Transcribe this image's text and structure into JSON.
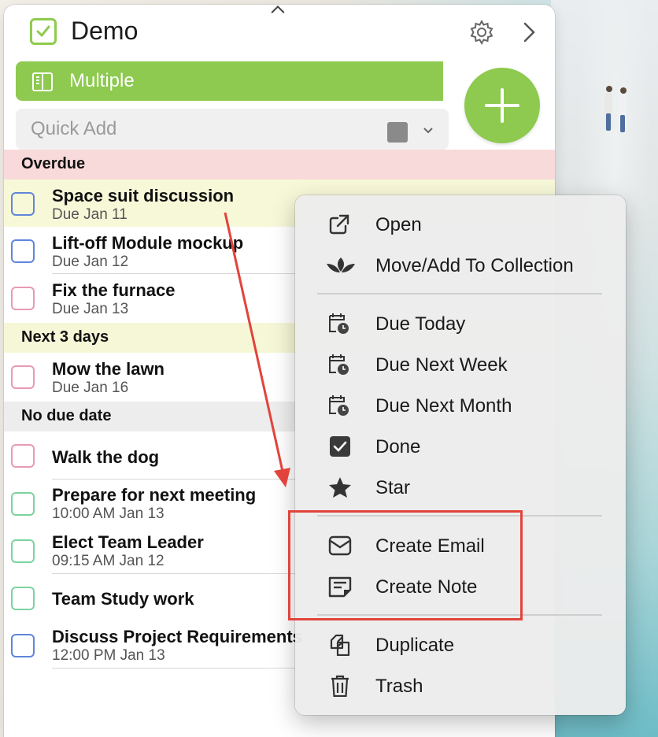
{
  "window": {
    "title": "Demo"
  },
  "filter": {
    "label": "Multiple"
  },
  "quick_add": {
    "placeholder": "Quick Add"
  },
  "sections": {
    "overdue": "Overdue",
    "next_days": "Next 3 days",
    "no_due": "No due date"
  },
  "tasks": [
    {
      "title": "Space suit discussion",
      "subtitle": "Due Jan 11",
      "color": "#5f86d9"
    },
    {
      "title": "Lift-off Module mockup",
      "subtitle": "Due Jan 12",
      "color": "#5f86d9"
    },
    {
      "title": "Fix the furnace",
      "subtitle": "Due Jan 13",
      "color": "#e89ab4"
    },
    {
      "title": "Mow the lawn",
      "subtitle": "Due Jan 16",
      "color": "#e89ab4"
    },
    {
      "title": "Walk the dog",
      "subtitle": "",
      "color": "#e89ab4"
    },
    {
      "title": "Prepare for next meeting",
      "subtitle": "10:00 AM Jan 13",
      "color": "#7dd3a1"
    },
    {
      "title": "Elect Team Leader",
      "subtitle": "09:15 AM Jan 12",
      "color": "#7dd3a1"
    },
    {
      "title": "Team Study work",
      "subtitle": "",
      "color": "#7dd3a1"
    },
    {
      "title": "Discuss Project Requirements",
      "subtitle": "12:00 PM Jan 13",
      "color": "#5f86d9"
    }
  ],
  "context_menu": {
    "items": [
      {
        "label": "Open",
        "icon": "open-external-icon"
      },
      {
        "label": "Move/Add To Collection",
        "icon": "collection-icon"
      },
      {
        "label": "Due Today",
        "icon": "calendar-clock-icon"
      },
      {
        "label": "Due Next Week",
        "icon": "calendar-clock-icon"
      },
      {
        "label": "Due Next Month",
        "icon": "calendar-clock-icon"
      },
      {
        "label": "Done",
        "icon": "checkbox-icon"
      },
      {
        "label": "Star",
        "icon": "star-icon"
      },
      {
        "label": "Create Email",
        "icon": "envelope-icon"
      },
      {
        "label": "Create Note",
        "icon": "note-icon"
      },
      {
        "label": "Duplicate",
        "icon": "duplicate-icon"
      },
      {
        "label": "Trash",
        "icon": "trash-icon"
      }
    ]
  },
  "colors": {
    "accent_green": "#8dca4f",
    "overdue_bg": "#f9dadb",
    "next_bg": "#f6f7d7",
    "annotation_red": "#e2433a"
  }
}
